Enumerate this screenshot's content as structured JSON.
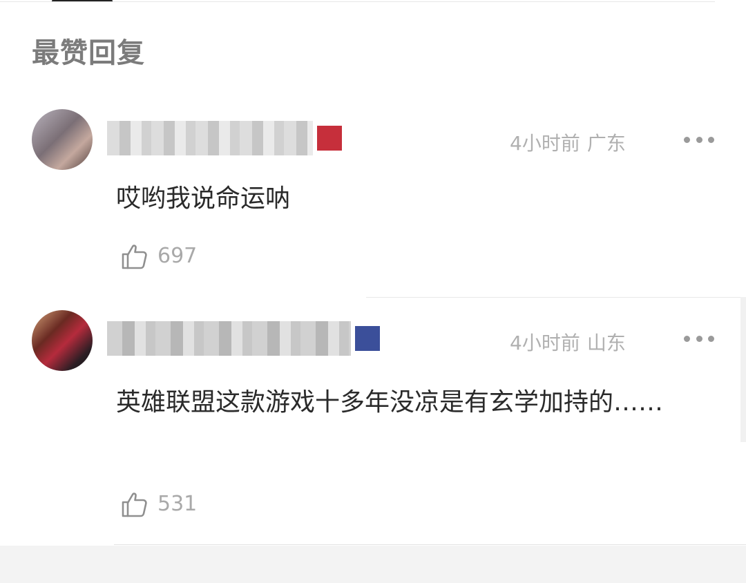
{
  "section_title": "最赞回复",
  "comments": [
    {
      "time": "4小时前",
      "region": "广东",
      "content": "哎哟我说命运呐",
      "likes": "697",
      "badge_color": "#c62f3b"
    },
    {
      "time": "4小时前",
      "region": "山东",
      "content": "英雄联盟这款游戏十多年没凉是有玄学加持的……",
      "likes": "531",
      "badge_color": "#3b4f9a"
    }
  ],
  "icons": {
    "like": "thumbs-up-icon",
    "more": "more-dots-icon"
  }
}
